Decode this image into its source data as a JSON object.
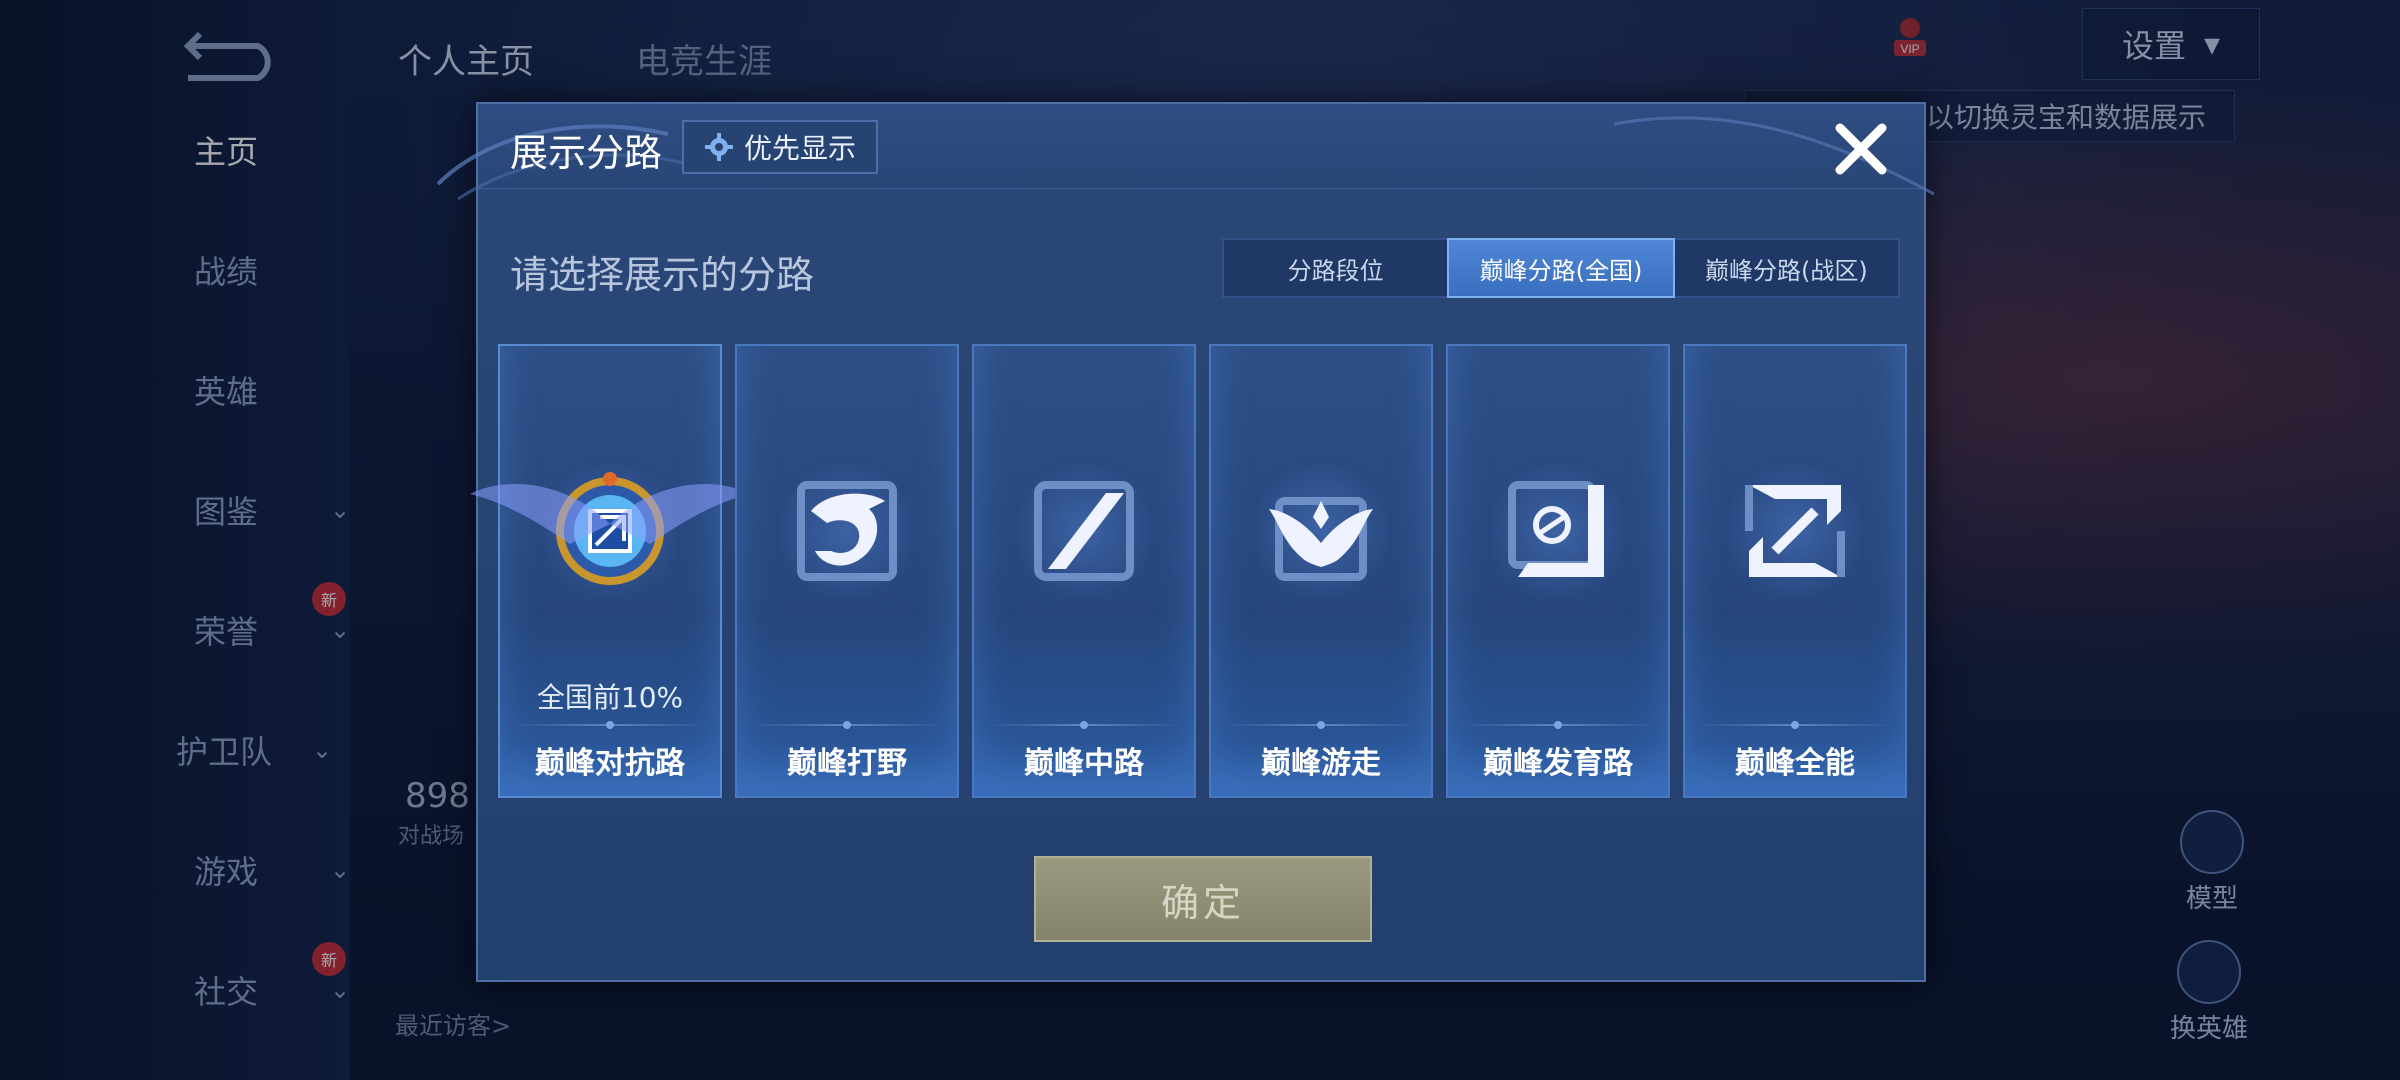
{
  "header": {
    "tabs": [
      {
        "label": "个人主页",
        "active": true
      },
      {
        "label": "电竞生涯",
        "active": false
      }
    ],
    "settings_label": "设置"
  },
  "left_nav": {
    "items": [
      {
        "label": "主页",
        "active": true,
        "chevron": false,
        "new": false
      },
      {
        "label": "战绩",
        "active": false,
        "chevron": false,
        "new": false
      },
      {
        "label": "英雄",
        "active": false,
        "chevron": false,
        "new": false
      },
      {
        "label": "图鉴",
        "active": false,
        "chevron": true,
        "new": false
      },
      {
        "label": "荣誉",
        "active": false,
        "chevron": true,
        "new": true
      },
      {
        "label": "护卫队",
        "active": false,
        "chevron": true,
        "new": false
      },
      {
        "label": "游戏",
        "active": false,
        "chevron": true,
        "new": false
      },
      {
        "label": "社交",
        "active": false,
        "chevron": true,
        "new": true
      }
    ],
    "new_badge_label": "新"
  },
  "background": {
    "hint_text": "以切换灵宝和数据展示",
    "score_partial": "898",
    "score_sub_partial": "对战场",
    "recent_visitors_label": "最近访客>",
    "side_buttons": [
      {
        "label": "模型"
      },
      {
        "label": "换英雄"
      }
    ]
  },
  "modal": {
    "title": "展示分路",
    "priority_button_label": "优先显示",
    "subtitle": "请选择展示的分路",
    "tabs": [
      {
        "label": "分路段位",
        "active": false
      },
      {
        "label": "巅峰分路(全国)",
        "active": true
      },
      {
        "label": "巅峰分路(战区)",
        "active": false
      }
    ],
    "cards": [
      {
        "name": "巅峰对抗路",
        "rank_text": "全国前10%",
        "selected": true,
        "icon": "clash-lane-badge-icon"
      },
      {
        "name": "巅峰打野",
        "rank_text": "",
        "selected": false,
        "icon": "jungle-dragon-icon"
      },
      {
        "name": "巅峰中路",
        "rank_text": "",
        "selected": false,
        "icon": "mid-lane-slash-icon"
      },
      {
        "name": "巅峰游走",
        "rank_text": "",
        "selected": false,
        "icon": "roam-wings-icon"
      },
      {
        "name": "巅峰发育路",
        "rank_text": "",
        "selected": false,
        "icon": "farm-lane-icon"
      },
      {
        "name": "巅峰全能",
        "rank_text": "",
        "selected": false,
        "icon": "all-round-icon"
      }
    ],
    "confirm_label": "确定"
  },
  "colors": {
    "accent_blue": "#3a6fbf",
    "modal_bg": "#2b4878",
    "confirm_disabled": "#8f8f75",
    "badge_red": "#c4303a"
  }
}
